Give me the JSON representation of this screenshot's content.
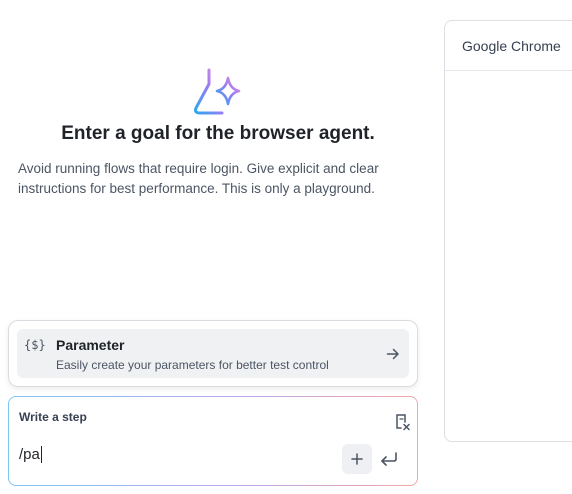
{
  "hero": {
    "icon": "flask-sparkle-icon",
    "title": "Enter a goal for the browser agent.",
    "description": "Avoid running flows that require login. Give explicit and clear instructions for best performance. This is only a playground."
  },
  "browser": {
    "title": "Google Chrome"
  },
  "suggestion": {
    "icon_text": "{$}",
    "title": "Parameter",
    "subtitle": "Easily create your parameters for better test control",
    "icon": "arrow-right-icon"
  },
  "step_input": {
    "label": "Write a step",
    "value": "/pa",
    "clear_icon": "clear-format-icon",
    "add_icon": "plus-icon",
    "submit_icon": "enter-icon"
  },
  "colors": {
    "accent_gradient": [
      "#2aa8f2",
      "#9b7cf3",
      "#f08fd0"
    ],
    "input_border_gradient": [
      "#7cc6f5",
      "#b9a7f0",
      "#f4a6a6"
    ]
  }
}
